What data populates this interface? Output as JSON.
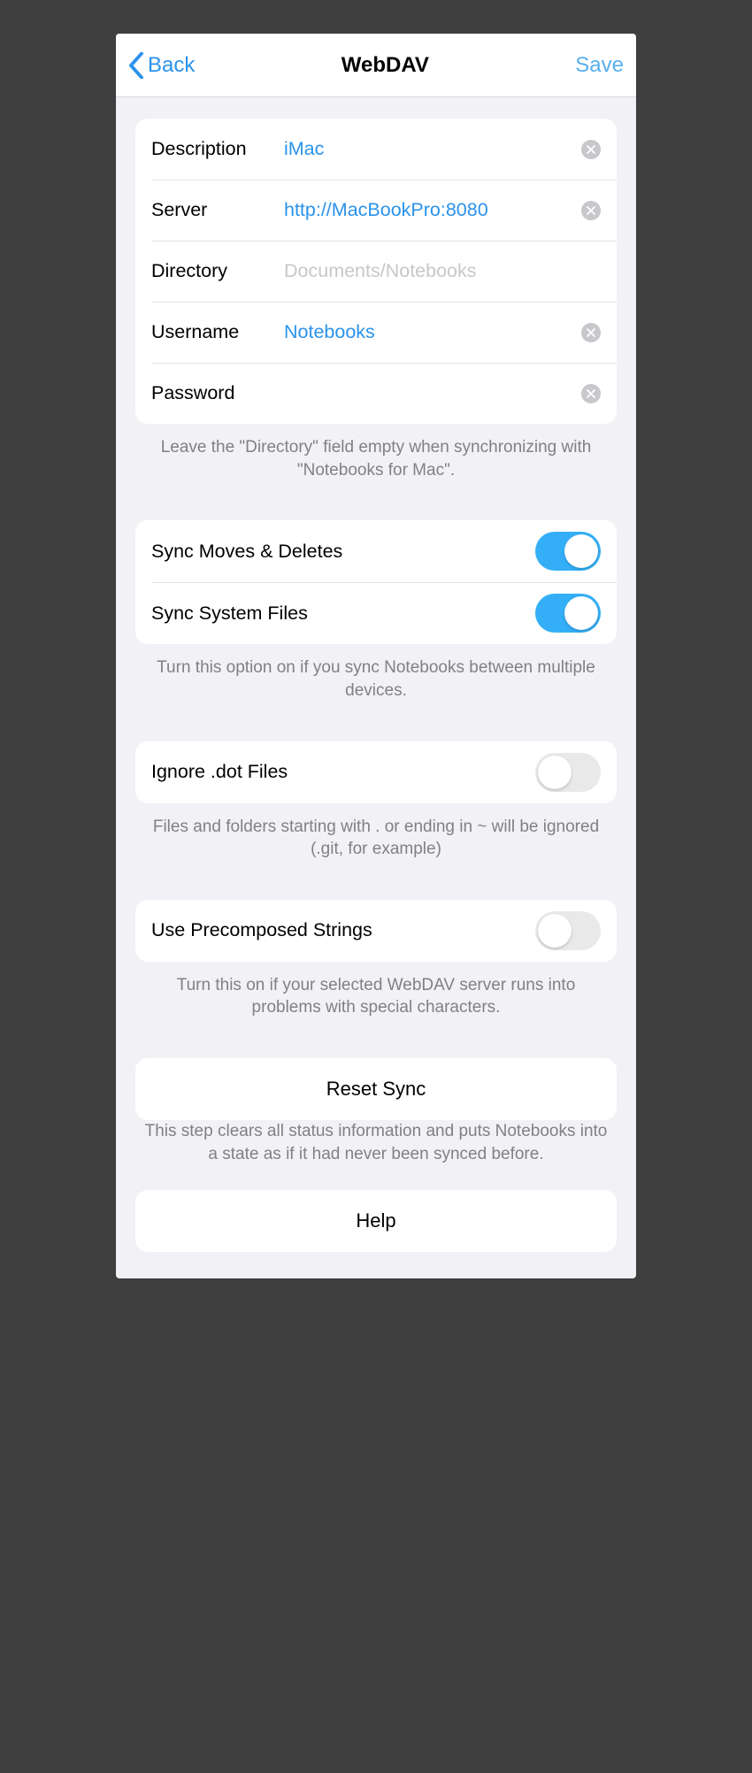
{
  "nav": {
    "back": "Back",
    "title": "WebDAV",
    "save": "Save"
  },
  "server_fields": {
    "description": {
      "label": "Description",
      "value": "iMac",
      "placeholder": ""
    },
    "server": {
      "label": "Server",
      "value": "http://MacBookPro:8080",
      "placeholder": ""
    },
    "directory": {
      "label": "Directory",
      "value": "",
      "placeholder": "Documents/Notebooks"
    },
    "username": {
      "label": "Username",
      "value": "Notebooks",
      "placeholder": ""
    },
    "password": {
      "label": "Password",
      "value": "",
      "placeholder": ""
    }
  },
  "footers": {
    "server": "Leave the \"Directory\" field empty when synchronizing with \"Notebooks for Mac\".",
    "sync": "Turn this option on if you sync Notebooks between multiple devices.",
    "dot": "Files and folders starting with . or ending in ~ will be ignored (.git, for example)",
    "precomposed": "Turn this on if your selected WebDAV server runs into problems with special characters.",
    "reset": "This step clears all status information and puts Notebooks into a state as if it had never been synced before."
  },
  "toggles": {
    "sync_moves": {
      "label": "Sync Moves & Deletes",
      "on": true
    },
    "sync_system": {
      "label": "Sync System Files",
      "on": true
    },
    "ignore_dot": {
      "label": "Ignore .dot Files",
      "on": false
    },
    "precomposed": {
      "label": "Use Precomposed Strings",
      "on": false
    }
  },
  "buttons": {
    "reset": "Reset Sync",
    "help": "Help"
  }
}
